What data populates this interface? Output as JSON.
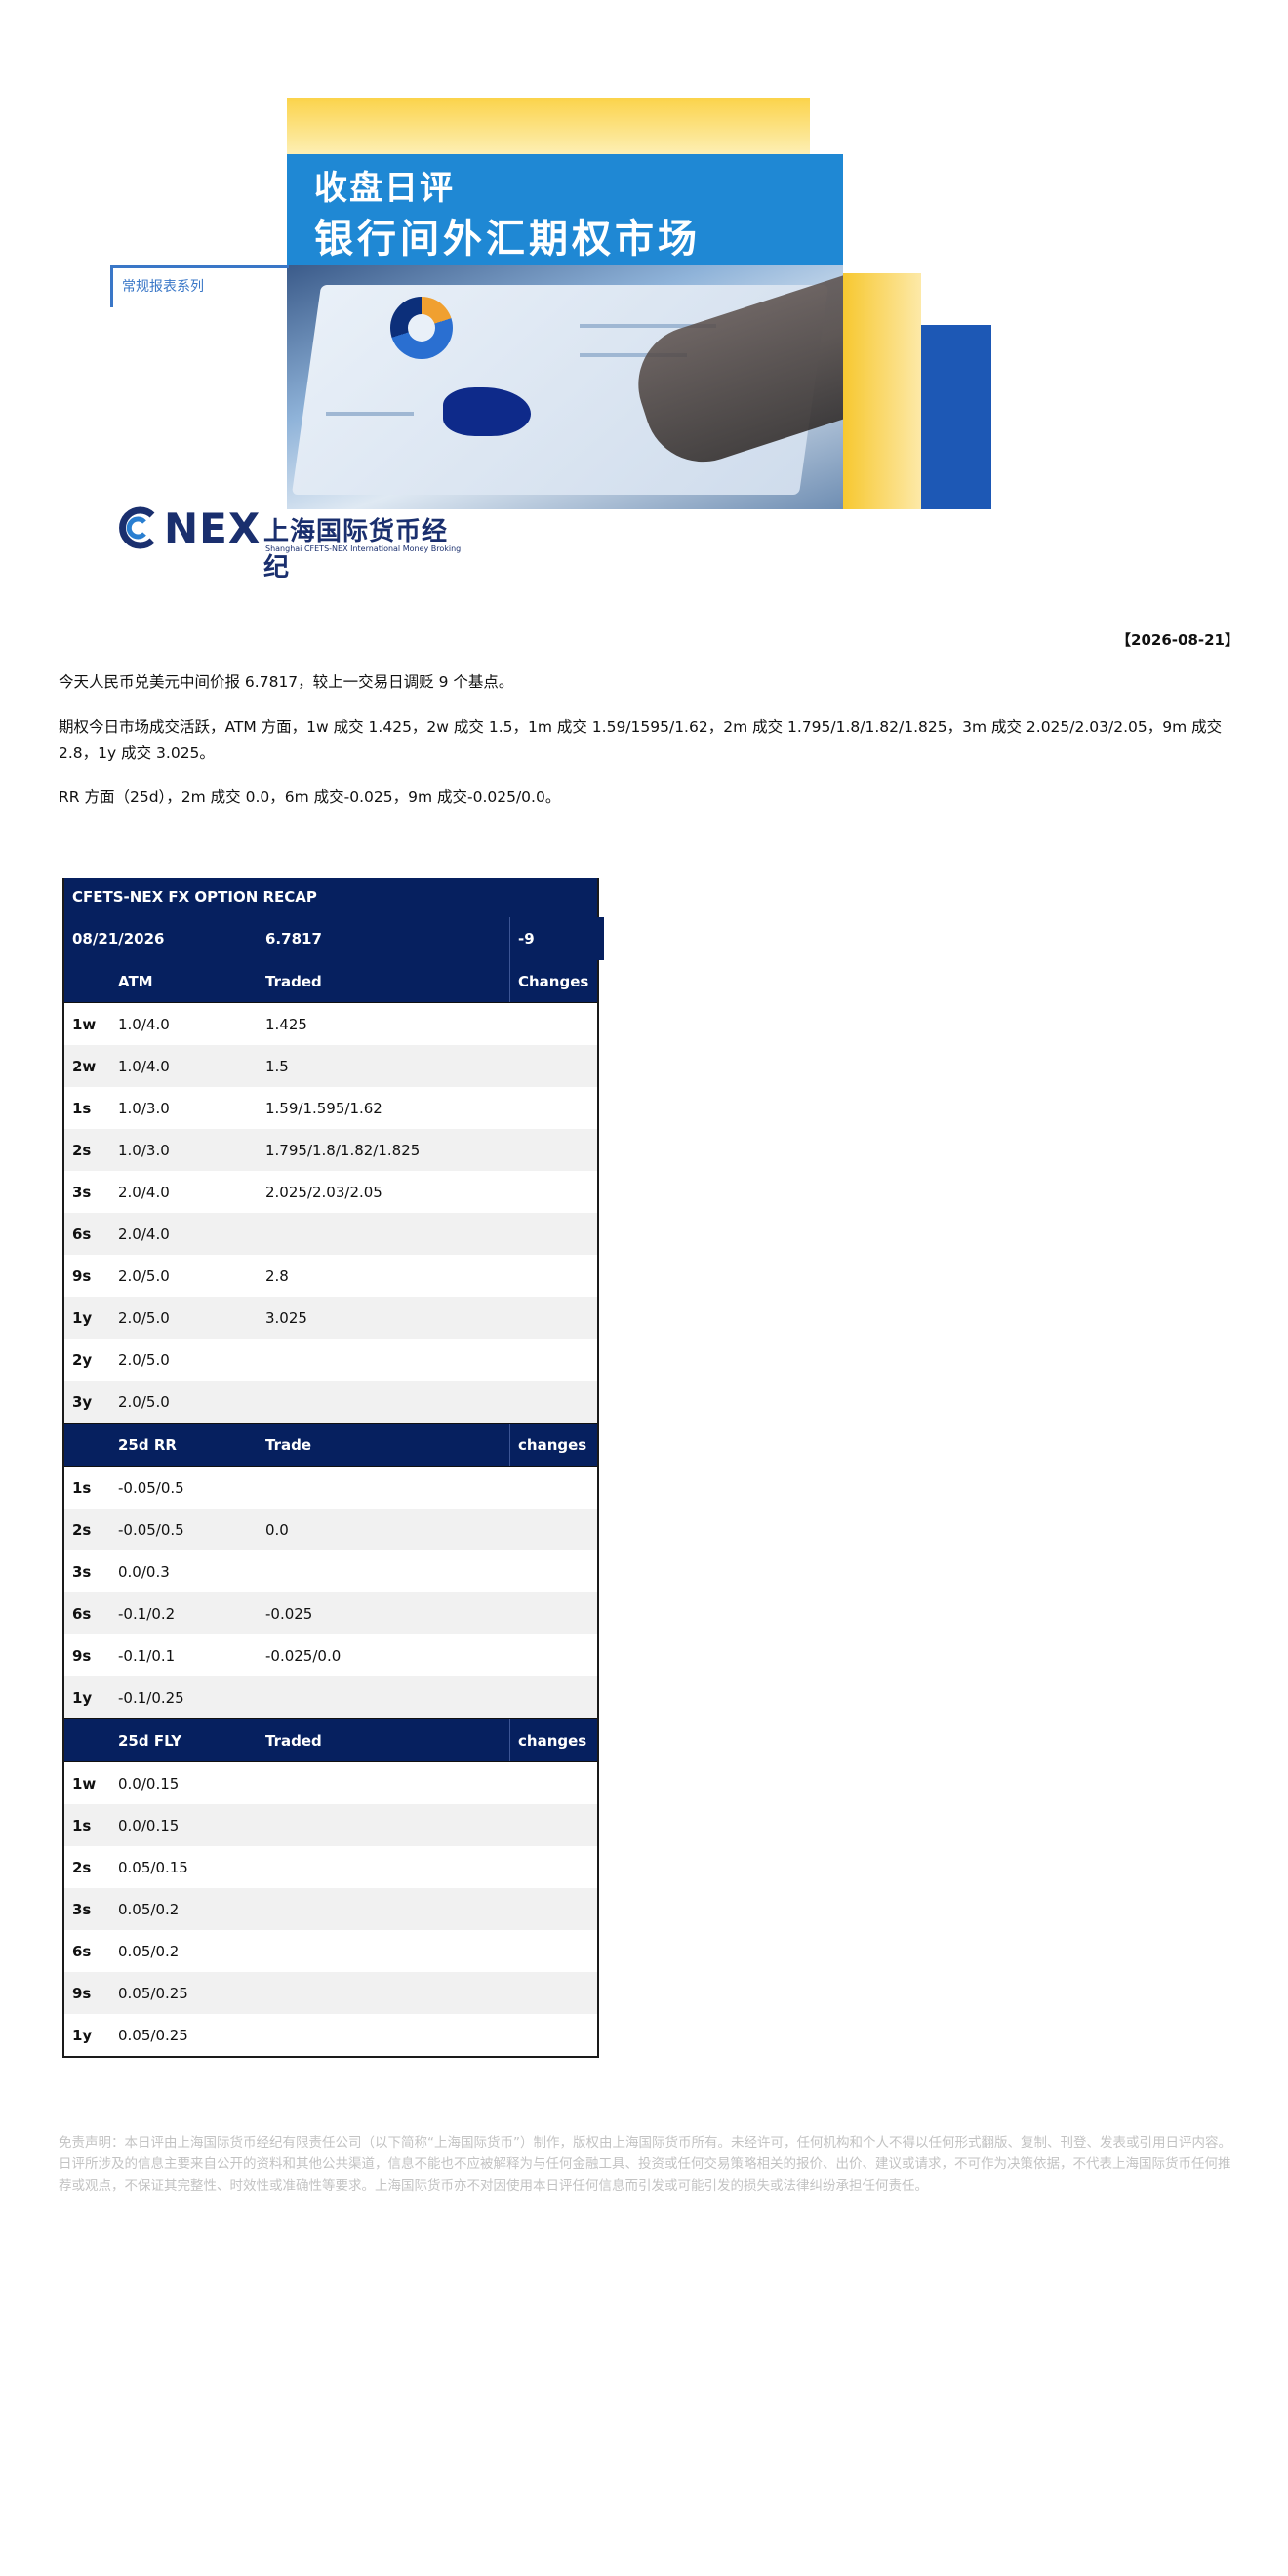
{
  "banner": {
    "title_line1": "收盘日评",
    "title_line2": "银行间外汇期权市场",
    "series_label": "常规报表系列",
    "logo_mark": "C",
    "logo_nex": "NEX",
    "logo_cn": "上海国际货币经纪",
    "logo_en": "Shanghai CFETS-NEX International Money Broking"
  },
  "report": {
    "date": "【2026-08-21】",
    "paragraph1": "今天人民币兑美元中间价报 6.7817，较上一交易日调贬 9 个基点。",
    "paragraph2": "期权今日市场成交活跃，ATM 方面，1w 成交 1.425，2w 成交 1.5，1m 成交 1.59/1595/1.62，2m 成交 1.795/1.8/1.82/1.825，3m 成交 2.025/2.03/2.05，9m 成交 2.8，1y 成交 3.025。",
    "paragraph3": "RR 方面（25d），2m 成交 0.0，6m 成交-0.025，9m 成交-0.025/0.0。"
  },
  "table": {
    "title": "CFETS-NEX FX OPTION RECAP",
    "date": "08/21/2026",
    "fixing": "6.7817",
    "change": "-9",
    "sections": [
      {
        "headers": [
          "",
          "ATM",
          "Traded",
          "Changes"
        ],
        "rows": [
          [
            "1w",
            "1.0/4.0",
            "1.425",
            ""
          ],
          [
            "2w",
            "1.0/4.0",
            "1.5",
            ""
          ],
          [
            "1s",
            "1.0/3.0",
            "1.59/1.595/1.62",
            ""
          ],
          [
            "2s",
            "1.0/3.0",
            "1.795/1.8/1.82/1.825",
            ""
          ],
          [
            "3s",
            "2.0/4.0",
            "2.025/2.03/2.05",
            ""
          ],
          [
            "6s",
            "2.0/4.0",
            "",
            ""
          ],
          [
            "9s",
            "2.0/5.0",
            "2.8",
            ""
          ],
          [
            "1y",
            "2.0/5.0",
            "3.025",
            ""
          ],
          [
            "2y",
            "2.0/5.0",
            "",
            ""
          ],
          [
            "3y",
            "2.0/5.0",
            "",
            ""
          ]
        ]
      },
      {
        "headers": [
          "",
          "25d RR",
          "Trade",
          "changes"
        ],
        "rows": [
          [
            "1s",
            "-0.05/0.5",
            "",
            ""
          ],
          [
            "2s",
            "-0.05/0.5",
            "0.0",
            ""
          ],
          [
            "3s",
            "0.0/0.3",
            "",
            ""
          ],
          [
            "6s",
            "-0.1/0.2",
            "-0.025",
            ""
          ],
          [
            "9s",
            "-0.1/0.1",
            "-0.025/0.0",
            ""
          ],
          [
            "1y",
            "-0.1/0.25",
            "",
            ""
          ]
        ]
      },
      {
        "headers": [
          "",
          "25d FLY",
          "Traded",
          "changes"
        ],
        "rows": [
          [
            "1w",
            "0.0/0.15",
            "",
            ""
          ],
          [
            "1s",
            "0.0/0.15",
            "",
            ""
          ],
          [
            "2s",
            "0.05/0.15",
            "",
            ""
          ],
          [
            "3s",
            "0.05/0.2",
            "",
            ""
          ],
          [
            "6s",
            "0.05/0.2",
            "",
            ""
          ],
          [
            "9s",
            "0.05/0.25",
            "",
            ""
          ],
          [
            "1y",
            "0.05/0.25",
            "",
            ""
          ]
        ]
      }
    ]
  },
  "disclaimer": "免责声明：本日评由上海国际货币经纪有限责任公司（以下简称“上海国际货币”）制作，版权由上海国际货币所有。未经许可，任何机构和个人不得以任何形式翻版、复制、刊登、发表或引用日评内容。日评所涉及的信息主要来自公开的资料和其他公共渠道，信息不能也不应被解释为与任何金融工具、投资或任何交易策略相关的报价、出价、建议或请求，不可作为决策依据，不代表上海国际货币任何推荐或观点，不保证其完整性、时效性或准确性等要求。上海国际货币亦不对因使用本日评任何信息而引发或可能引发的损失或法律纠纷承担任何责任。"
}
